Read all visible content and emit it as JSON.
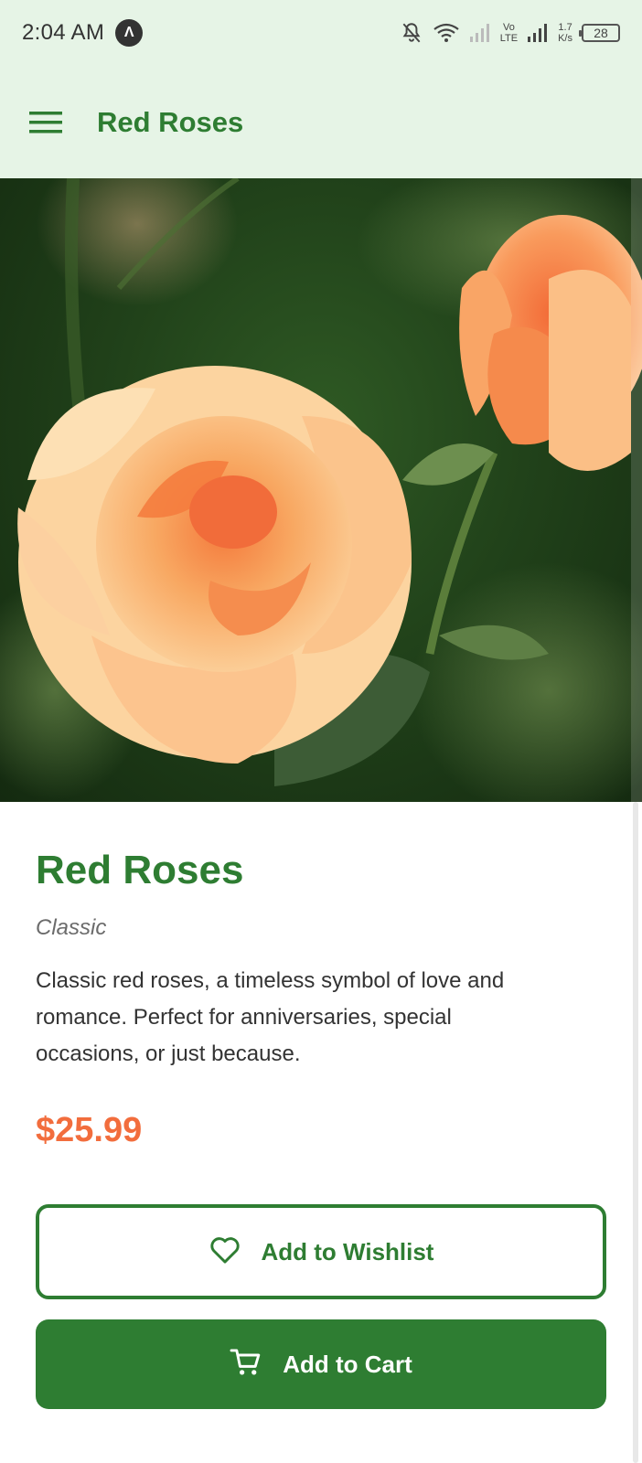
{
  "status_bar": {
    "time": "2:04 AM",
    "app_badge": "Λ",
    "network_speed_value": "1.7",
    "network_speed_unit": "K/s",
    "lte_label_top": "Vo",
    "lte_label_bottom": "LTE",
    "battery": "28",
    "icons": [
      "notifications-off-icon",
      "wifi-icon",
      "signal-icon",
      "signal-icon"
    ]
  },
  "app_bar": {
    "title": "Red Roses",
    "menu_icon": "hamburger-menu-icon"
  },
  "product": {
    "image_alt": "rose-photo",
    "title": "Red Roses",
    "category": "Classic",
    "description": "Classic red roses, a timeless symbol of love and romance. Perfect for anniversaries, special occasions, or just because.",
    "price": "$25.99"
  },
  "actions": {
    "wishlist_label": "Add to Wishlist",
    "wishlist_icon": "heart-icon",
    "cart_label": "Add to Cart",
    "cart_icon": "cart-icon"
  },
  "colors": {
    "primary": "#2e7d32",
    "app_bar_bg": "#e6f4e6",
    "price": "#f26d3d",
    "text": "#333333",
    "muted": "#6b6b6b"
  }
}
